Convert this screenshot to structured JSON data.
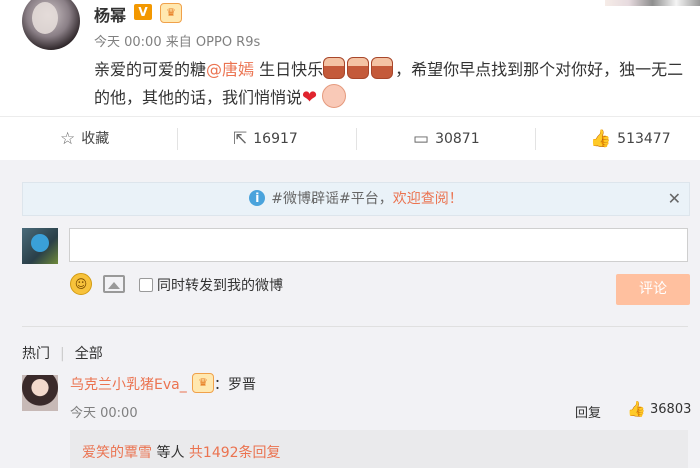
{
  "post": {
    "user_name": "杨幂",
    "verified_badge": "V",
    "time": "今天 00:00",
    "source_prefix": "来自",
    "source": "OPPO R9s",
    "text_part1": "亲爱的可爱的糖",
    "mention": "@唐嫣",
    "text_part2": " 生日快乐",
    "text_part3": "，希望你早点找到那个对你好，独一无二的他，其他的话，我们悄悄说"
  },
  "actions": {
    "favorite_label": "收藏",
    "repost_count": "16917",
    "comment_count": "30871",
    "like_count": "513477"
  },
  "notice": {
    "text_prefix": "#微博辟谣#平台，",
    "text_highlight": "欢迎查阅！"
  },
  "composer": {
    "input_value": "",
    "repost_label": "同时转发到我的微博",
    "submit_label": "评论"
  },
  "tabs": {
    "hot": "热门",
    "all": "全部"
  },
  "comment": {
    "user_name": "乌克兰小乳猪Eva_",
    "colon": "：",
    "text": "罗晋",
    "time": "今天 00:00",
    "reply_label": "回复",
    "like_count": "36803",
    "sub_user": "爱笑的覃雪",
    "sub_middle": " 等人 ",
    "sub_count": "共1492条回复"
  },
  "colors": {
    "accent": "#eb7350",
    "submit_disabled": "#ffc09f",
    "panel_bg": "#f2f2f5",
    "notice_bg": "#eaf2f8"
  }
}
